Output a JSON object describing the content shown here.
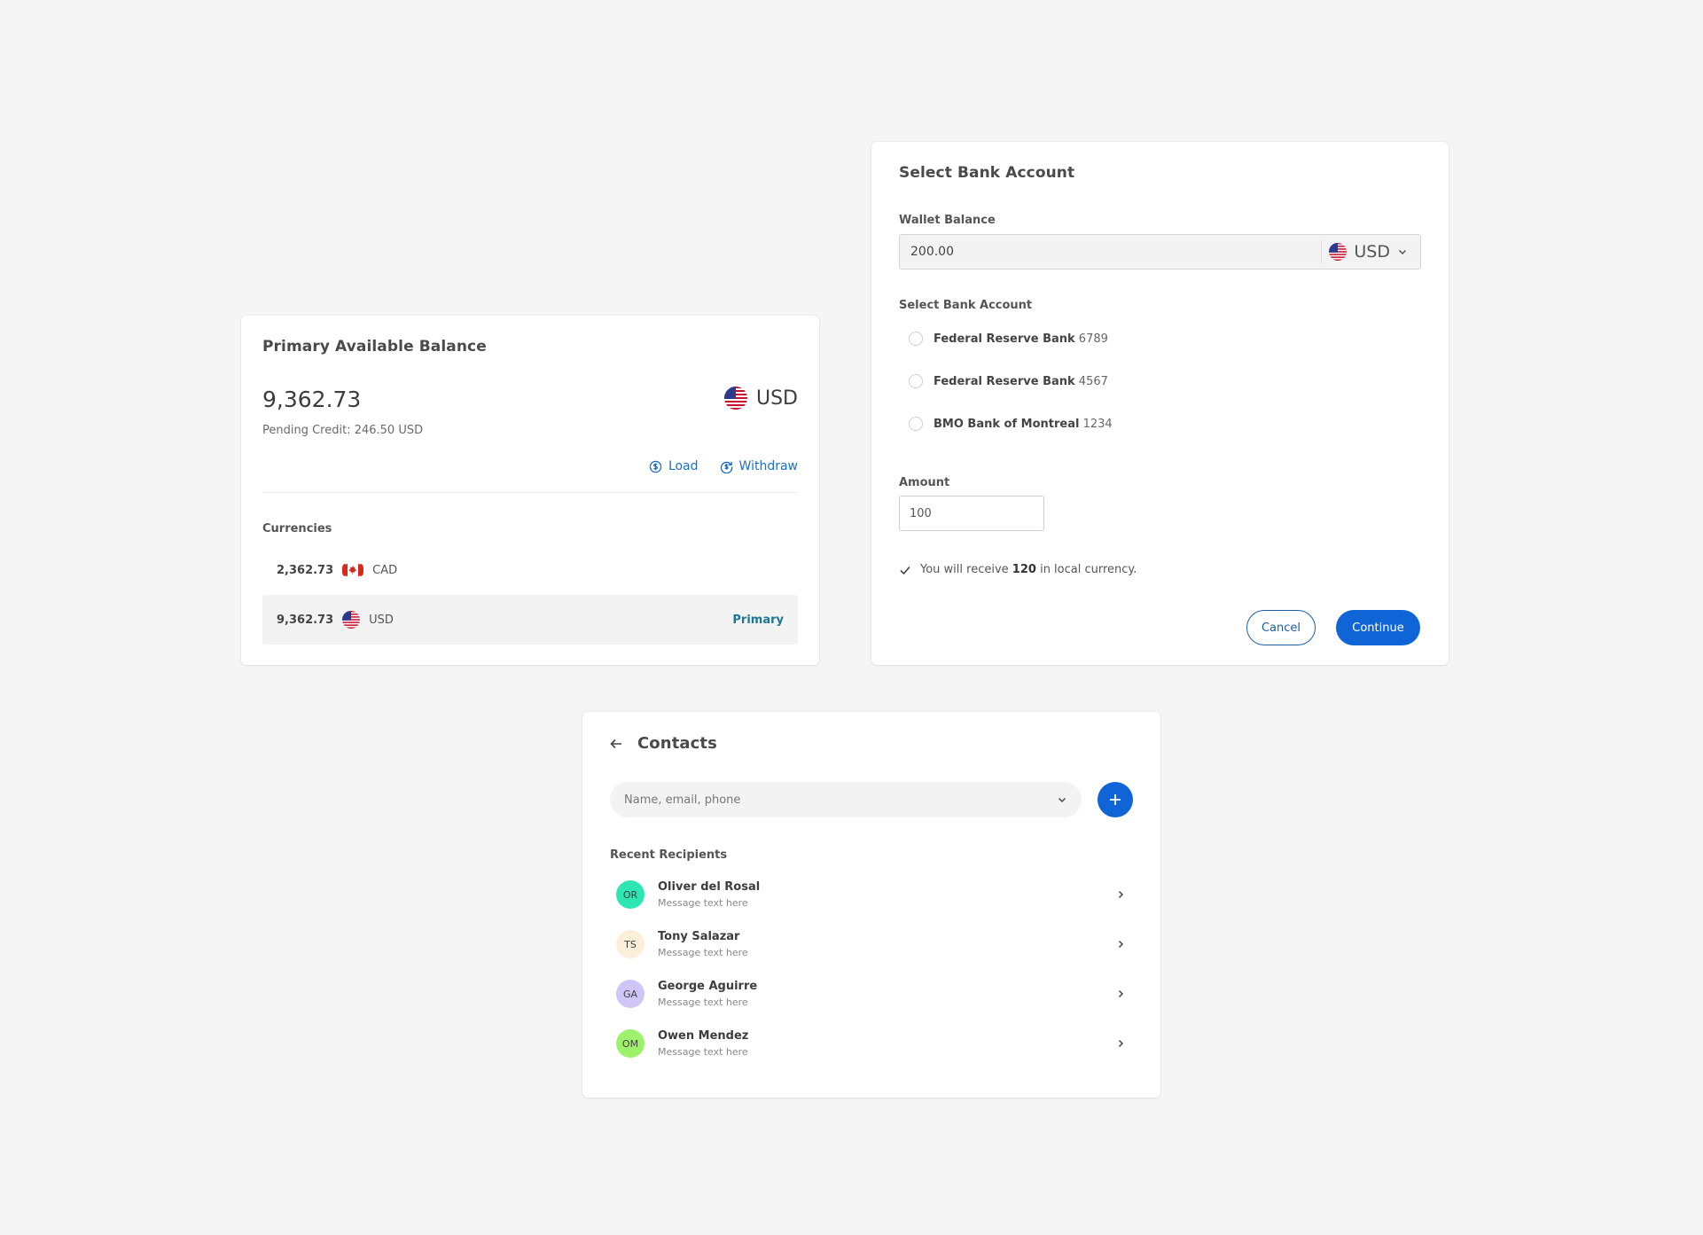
{
  "balance": {
    "title": "Primary Available Balance",
    "amount": "9,362.73",
    "currency": "USD",
    "pending": "Pending Credit: 246.50 USD",
    "load_label": "Load",
    "withdraw_label": "Withdraw",
    "currencies_label": "Currencies",
    "currencies": [
      {
        "amount": "2,362.73",
        "code": "CAD",
        "flag": "canada-flag"
      },
      {
        "amount": "9,362.73",
        "code": "USD",
        "flag": "us-flag",
        "badge": "Primary"
      }
    ]
  },
  "bank": {
    "title": "Select Bank Account",
    "wallet_label": "Wallet Balance",
    "wallet_value": "200.00",
    "wallet_currency": "USD",
    "select_label": "Select Bank Account",
    "accounts": [
      {
        "name": "Federal Reserve Bank",
        "number": "6789"
      },
      {
        "name": "Federal Reserve Bank",
        "number": "4567"
      },
      {
        "name": "BMO Bank of Montreal",
        "number": "1234"
      }
    ],
    "amount_label": "Amount",
    "amount_value": "100",
    "receive_prefix": "You will receive",
    "receive_amount": "120",
    "receive_suffix": "in local currency.",
    "cancel_label": "Cancel",
    "continue_label": "Continue"
  },
  "contacts": {
    "title": "Contacts",
    "search_placeholder": "Name, email, phone",
    "recent_label": "Recent Recipients",
    "recipients": [
      {
        "initials": "OR",
        "name": "Oliver del Rosal",
        "message": "Message text here",
        "color": "#2ee6b4"
      },
      {
        "initials": "TS",
        "name": "Tony Salazar",
        "message": "Message text here",
        "color": "#fcefd9"
      },
      {
        "initials": "GA",
        "name": "George Aguirre",
        "message": "Message text here",
        "color": "#cfc6f7"
      },
      {
        "initials": "OM",
        "name": "Owen Mendez",
        "message": "Message text here",
        "color": "#9ef26b"
      }
    ]
  },
  "colors": {
    "accent": "#0f64d6",
    "link": "#1d6fc4",
    "primary_badge": "#1a7796",
    "background": "#f5f5f5"
  }
}
